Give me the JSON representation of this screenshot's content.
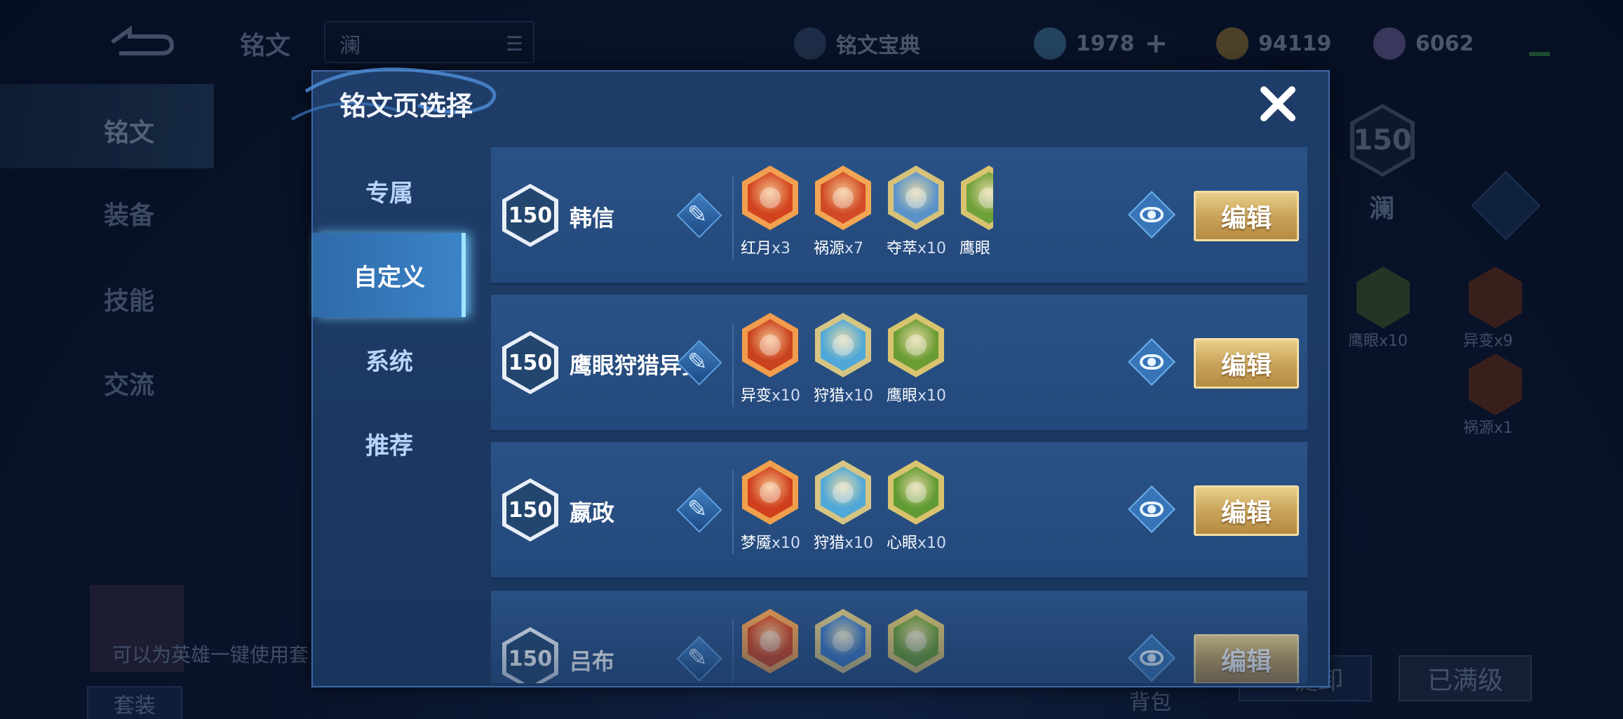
{
  "background": {
    "header_title": "铭文",
    "search_value": "澜",
    "codex_label": "铭文宝典",
    "resources": [
      {
        "icon": "crystal-icon",
        "value": "1978"
      },
      {
        "icon": "gold-coin-icon",
        "value": "94119"
      },
      {
        "icon": "rune-fragment-icon",
        "value": "6062"
      }
    ],
    "left_menu": [
      "铭文",
      "装备",
      "技能",
      "交流"
    ],
    "hero_level": "150",
    "hero_name": "澜",
    "side_runes": [
      {
        "name": "鹰眼",
        "count": "x10"
      },
      {
        "name": "异变",
        "count": "x9"
      },
      {
        "name": "祸源",
        "count": "x1"
      }
    ],
    "hint_text": "可以为英雄一键使用套",
    "suit_label": "套装",
    "bag_label": "背包",
    "unload_label": "一键卸",
    "maxed_label": "已满级"
  },
  "modal": {
    "title": "铭文页选择",
    "close_icon": "close-icon",
    "tabs": [
      {
        "label": "专属",
        "active": false
      },
      {
        "label": "自定义",
        "active": true
      },
      {
        "label": "系统",
        "active": false
      },
      {
        "label": "推荐",
        "active": false
      }
    ],
    "pages": [
      {
        "level": "150",
        "name": "韩信",
        "edit_label": "编辑",
        "runes": [
          {
            "name": "红月",
            "count": "x3",
            "color": "#d2441f",
            "rim": "#f0a050"
          },
          {
            "name": "祸源",
            "count": "x7",
            "color": "#d04a25",
            "rim": "#f2a654"
          },
          {
            "name": "夺萃",
            "count": "x10",
            "color": "#5b93c9",
            "rim": "#d7c27a"
          },
          {
            "name": "鹰眼",
            "count": "",
            "color": "#6fa13a",
            "rim": "#d8c36f"
          }
        ]
      },
      {
        "level": "150",
        "name": "鹰眼狩猎异变",
        "edit_label": "编辑",
        "runes": [
          {
            "name": "异变",
            "count": "x10",
            "color": "#c9421e",
            "rim": "#f19c4c"
          },
          {
            "name": "狩猎",
            "count": "x10",
            "color": "#4fa8d7",
            "rim": "#d6c582"
          },
          {
            "name": "鹰眼",
            "count": "x10",
            "color": "#6a9c33",
            "rim": "#d8c36f"
          }
        ]
      },
      {
        "level": "150",
        "name": "嬴政",
        "edit_label": "编辑",
        "runes": [
          {
            "name": "梦魇",
            "count": "x10",
            "color": "#cf3f1d",
            "rim": "#f0a04c"
          },
          {
            "name": "狩猎",
            "count": "x10",
            "color": "#4fa8d7",
            "rim": "#d6c582"
          },
          {
            "name": "心眼",
            "count": "x10",
            "color": "#5f9a32",
            "rim": "#d8c36f"
          }
        ]
      },
      {
        "level": "150",
        "name": "吕布",
        "edit_label": "编辑",
        "runes": [
          {
            "name": "",
            "count": "",
            "color": "#d2441f",
            "rim": "#f0a050"
          },
          {
            "name": "",
            "count": "",
            "color": "#3a78c2",
            "rim": "#d6c582"
          },
          {
            "name": "",
            "count": "",
            "color": "#6a9c33",
            "rim": "#d8c36f"
          }
        ]
      }
    ]
  }
}
